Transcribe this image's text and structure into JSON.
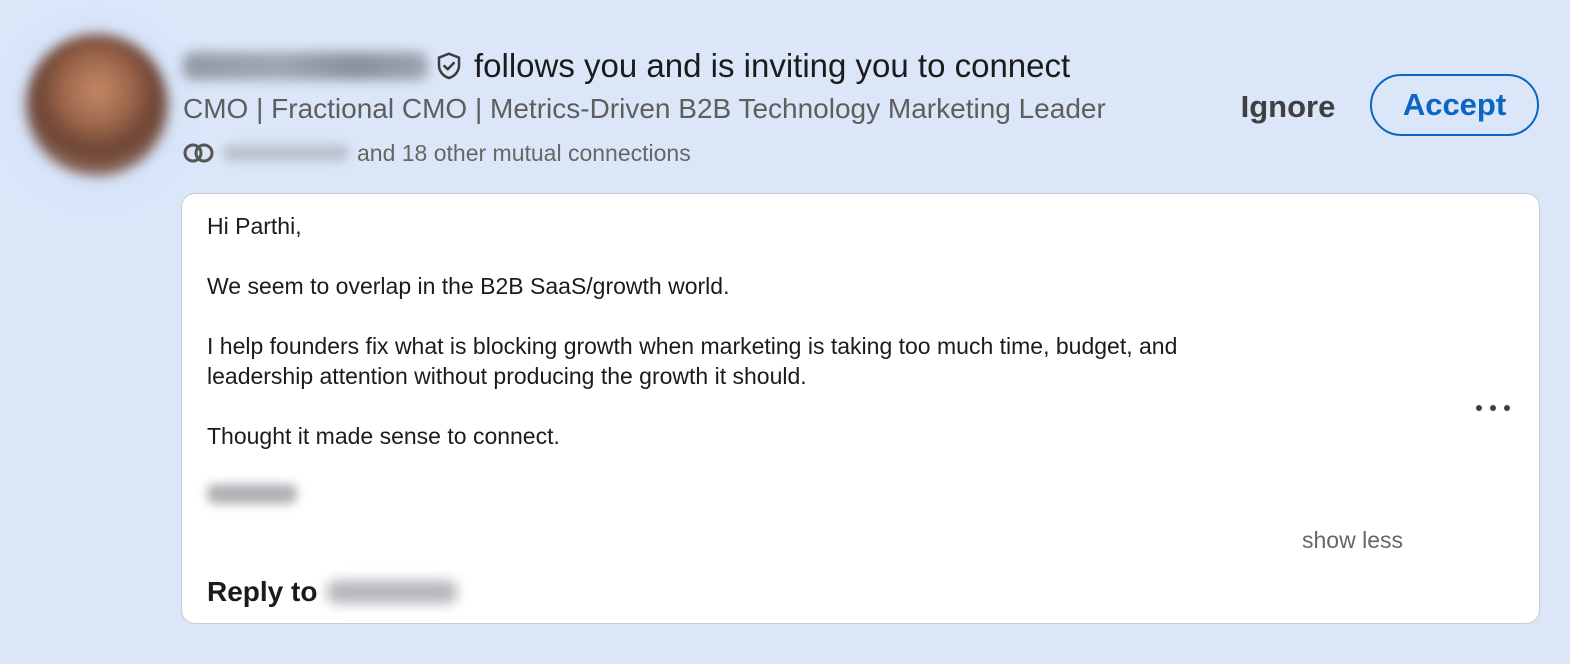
{
  "invitation": {
    "header_suffix": "follows you and is inviting you to connect",
    "headline": "CMO | Fractional CMO | Metrics-Driven B2B Technology Marketing Leader",
    "mutual_text": "and 18 other mutual connections",
    "icons": {
      "verified": "verified-shield-icon",
      "mutual": "mutual-connections-icon"
    }
  },
  "actions": {
    "ignore_label": "Ignore",
    "accept_label": "Accept",
    "accent_color": "#0a66c2"
  },
  "message": {
    "lines": [
      "Hi Parthi,",
      "We seem to overlap in the B2B SaaS/growth world.",
      "I help founders fix what is blocking growth when marketing is taking too much time, budget, and",
      "leadership attention without producing the growth it should.",
      "Thought it made sense to connect."
    ],
    "more_icon": "more-options-icon",
    "show_less_label": "show less",
    "reply_label": "Reply to"
  }
}
